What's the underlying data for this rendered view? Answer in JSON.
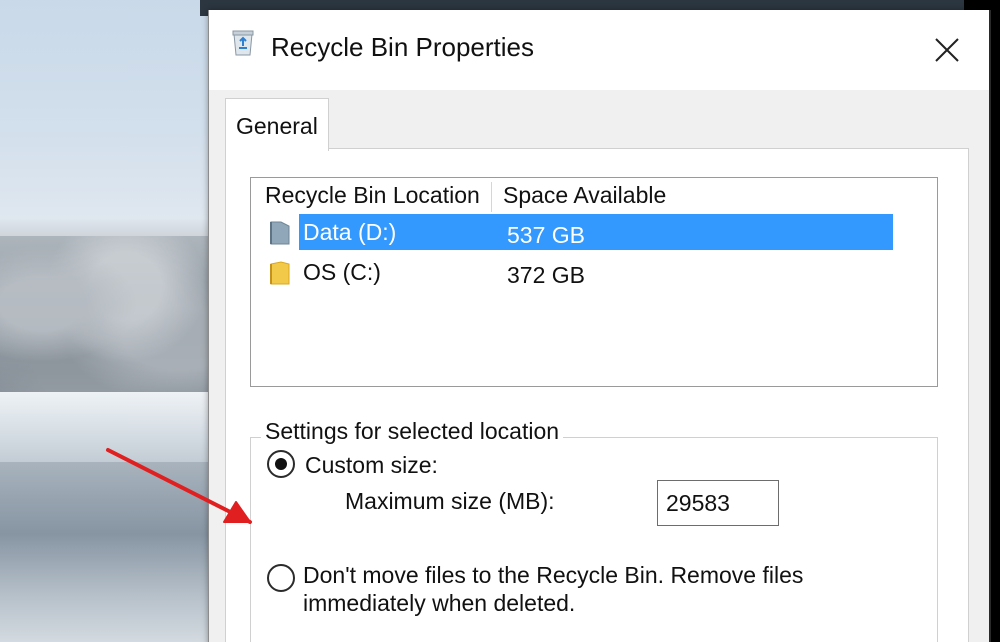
{
  "window": {
    "title": "Recycle Bin Properties",
    "icon": "recycle-bin-icon",
    "close_icon": "close-icon"
  },
  "tabs": [
    {
      "label": "General",
      "active": true
    }
  ],
  "location_list": {
    "columns": [
      "Recycle Bin Location",
      "Space Available"
    ],
    "rows": [
      {
        "name": "Data (D:)",
        "space": "537 GB",
        "selected": true,
        "icon": "drive-folder-icon"
      },
      {
        "name": "OS (C:)",
        "space": "372 GB",
        "selected": false,
        "icon": "folder-icon"
      }
    ]
  },
  "settings": {
    "legend": "Settings for selected location",
    "custom_size": {
      "label": "Custom size:",
      "checked": true
    },
    "max_size": {
      "label": "Maximum size (MB):",
      "value": "29583"
    },
    "dont_move": {
      "label_line1": "Don't move files to the Recycle Bin. Remove files",
      "label_line2": "immediately when deleted.",
      "checked": false
    }
  },
  "annotation": {
    "arrow_color": "#e02020"
  },
  "colors": {
    "selection": "#3399ff",
    "panel_bg": "#f0f0f0"
  }
}
